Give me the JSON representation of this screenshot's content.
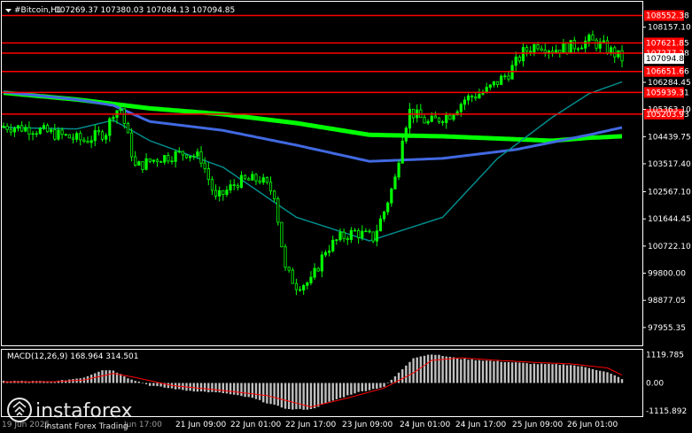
{
  "header": {
    "symbol": "#Bitcoin,H1",
    "ohlc": "107269.37 107380.03 107084.13 107094.85"
  },
  "watermark": {
    "brand": "instaforex",
    "tagline": "Instant Forex Trading"
  },
  "colors": {
    "background": "#000000",
    "frame": "#ffffff",
    "candle": "#00ff00",
    "ema_fast": "#008b8b",
    "ema_mid": "#4169e1",
    "ema_slow": "#00ff00",
    "level_line": "#ff0000",
    "macd_hist": "#c0c0c0",
    "macd_signal": "#ff0000"
  },
  "chart_data": [
    {
      "type": "candlestick",
      "ylim": [
        97500,
        108900
      ],
      "y_ticks": [
        "108157.10",
        "106284.45",
        "105363.10",
        "104439.75",
        "103517.40",
        "102567.10",
        "101644.45",
        "100722.10",
        "99800.00",
        "98877.05",
        "97955.35"
      ],
      "current_price": "107094.85",
      "price_levels": [
        {
          "value": 108552.38,
          "label": "108552.38"
        },
        {
          "value": 107621.85,
          "label": "107621.85"
        },
        {
          "value": 107277.28,
          "label": "107277.28"
        },
        {
          "value": 106651.66,
          "label": "106651.66"
        },
        {
          "value": 105939.31,
          "label": "105939.31"
        },
        {
          "value": 105203.93,
          "label": "105203.93"
        }
      ],
      "x_labels": [
        "21 Jun 09:00",
        "22 Jun 01:00",
        "22 Jun 17:00",
        "23 Jun 09:00",
        "24 Jun 01:00",
        "24 Jun 17:00",
        "25 Jun 09:00",
        "26 Jun 01:00"
      ],
      "x_label_partial": [
        "19 Jun 2025",
        "Jun 17:00"
      ],
      "bar_count": 170,
      "close_path": [
        [
          0,
          104800
        ],
        [
          8,
          104700
        ],
        [
          15,
          104500
        ],
        [
          22,
          104300
        ],
        [
          28,
          104600
        ],
        [
          30,
          105300
        ],
        [
          32,
          105400
        ],
        [
          36,
          103400
        ],
        [
          42,
          103700
        ],
        [
          50,
          103900
        ],
        [
          54,
          103700
        ],
        [
          58,
          102300
        ],
        [
          64,
          102900
        ],
        [
          70,
          103000
        ],
        [
          74,
          102500
        ],
        [
          77,
          99900
        ],
        [
          80,
          99400
        ],
        [
          84,
          99500
        ],
        [
          88,
          100600
        ],
        [
          92,
          101000
        ],
        [
          96,
          101200
        ],
        [
          101,
          101000
        ],
        [
          104,
          101900
        ],
        [
          107,
          103000
        ],
        [
          109,
          104500
        ],
        [
          111,
          105300
        ],
        [
          116,
          104900
        ],
        [
          122,
          105200
        ],
        [
          126,
          105700
        ],
        [
          132,
          106000
        ],
        [
          138,
          106600
        ],
        [
          142,
          107300
        ],
        [
          146,
          107600
        ],
        [
          150,
          107400
        ],
        [
          155,
          107500
        ],
        [
          160,
          107700
        ],
        [
          164,
          107500
        ],
        [
          169,
          107090
        ]
      ],
      "moving_averages": [
        {
          "color": "#00ff00",
          "points": [
            [
              0,
              105930
            ],
            [
              20,
              105700
            ],
            [
              40,
              105400
            ],
            [
              60,
              105200
            ],
            [
              80,
              104900
            ],
            [
              100,
              104500
            ],
            [
              120,
              104450
            ],
            [
              140,
              104350
            ],
            [
              150,
              104300
            ],
            [
              160,
              104400
            ],
            [
              169,
              104450
            ]
          ]
        },
        {
          "color": "#4169e1",
          "points": [
            [
              0,
              105950
            ],
            [
              20,
              105700
            ],
            [
              30,
              105500
            ],
            [
              40,
              104950
            ],
            [
              60,
              104650
            ],
            [
              80,
              104150
            ],
            [
              100,
              103600
            ],
            [
              120,
              103700
            ],
            [
              140,
              104000
            ],
            [
              160,
              104500
            ],
            [
              169,
              104750
            ]
          ]
        },
        {
          "color": "#008b8b",
          "points": [
            [
              0,
              104750
            ],
            [
              20,
              104700
            ],
            [
              30,
              105000
            ],
            [
              40,
              104300
            ],
            [
              60,
              103400
            ],
            [
              80,
              101700
            ],
            [
              100,
              100900
            ],
            [
              120,
              101700
            ],
            [
              135,
              103700
            ],
            [
              150,
              105100
            ],
            [
              160,
              105900
            ],
            [
              169,
              106300
            ]
          ]
        }
      ]
    },
    {
      "type": "macd",
      "label": "MACD(12,26,9) 168.964 314.501",
      "params": [
        12,
        26,
        9
      ],
      "macd_value": 168.964,
      "signal_value": 314.501,
      "ylim": [
        -1250,
        1250
      ],
      "y_ticks": [
        "1119.785",
        "0.00",
        "-1115.892"
      ],
      "histogram_path": [
        [
          0,
          80
        ],
        [
          14,
          60
        ],
        [
          22,
          220
        ],
        [
          27,
          520
        ],
        [
          30,
          500
        ],
        [
          34,
          200
        ],
        [
          40,
          -100
        ],
        [
          50,
          -300
        ],
        [
          60,
          -400
        ],
        [
          68,
          -600
        ],
        [
          72,
          -800
        ],
        [
          78,
          -1050
        ],
        [
          84,
          -1050
        ],
        [
          90,
          -700
        ],
        [
          96,
          -400
        ],
        [
          104,
          -150
        ],
        [
          108,
          400
        ],
        [
          112,
          1000
        ],
        [
          117,
          1150
        ],
        [
          125,
          960
        ],
        [
          135,
          860
        ],
        [
          145,
          760
        ],
        [
          155,
          720
        ],
        [
          160,
          600
        ],
        [
          165,
          420
        ],
        [
          169,
          169
        ]
      ],
      "signal_path": [
        [
          0,
          40
        ],
        [
          14,
          50
        ],
        [
          22,
          120
        ],
        [
          30,
          380
        ],
        [
          36,
          220
        ],
        [
          46,
          -100
        ],
        [
          60,
          -300
        ],
        [
          72,
          -500
        ],
        [
          84,
          -950
        ],
        [
          94,
          -600
        ],
        [
          104,
          -200
        ],
        [
          112,
          400
        ],
        [
          117,
          900
        ],
        [
          125,
          1000
        ],
        [
          135,
          900
        ],
        [
          145,
          820
        ],
        [
          155,
          760
        ],
        [
          165,
          600
        ],
        [
          169,
          314
        ]
      ]
    }
  ]
}
